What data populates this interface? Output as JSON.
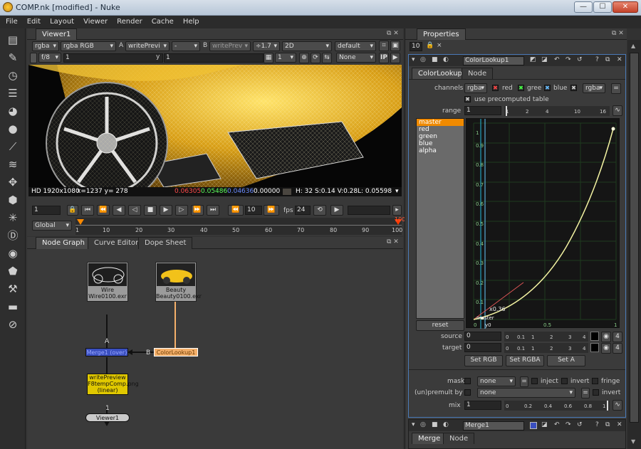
{
  "window": {
    "title": "COMP.nk [modified] - Nuke",
    "min": "—",
    "max": "☐",
    "close": "✕"
  },
  "menu": [
    "File",
    "Edit",
    "Layout",
    "Viewer",
    "Render",
    "Cache",
    "Help"
  ],
  "viewer": {
    "tab": "Viewer1",
    "row1": {
      "channels": "rgba",
      "display": "rgba RGB",
      "a_label": "A",
      "a_input": "writePrevi",
      "dash": "-",
      "b_label": "B",
      "b_input": "writePrev",
      "gain": "÷1.7",
      "mode": "2D",
      "lut": "default"
    },
    "row2": {
      "fstop": "f/8",
      "gain_val": "1",
      "y_label": "y",
      "y_val": "1",
      "frame": "1",
      "proxy": "None",
      "ip": "IP"
    },
    "status": {
      "format": "HD 1920x1080",
      "coords": "x=1237 y= 278",
      "r": "0.06305",
      "g": "0.05486",
      "b": "0.04636",
      "a": "0.00000",
      "hsv": "H: 32 S:0.14 V:0.28",
      "l": "L: 0.05598"
    },
    "timeline": {
      "frame": "1",
      "fps_label": "fps",
      "fps": "24",
      "range": "Global",
      "ticks": [
        "1",
        "10",
        "20",
        "30",
        "40",
        "50",
        "60",
        "70",
        "80",
        "90",
        "100"
      ],
      "end": "100"
    }
  },
  "nodegraph": {
    "tabs": [
      "Node Graph",
      "Curve Editor",
      "Dope Sheet"
    ],
    "nodes": {
      "wire": {
        "label": "Wire",
        "file": "Wire0100.exr"
      },
      "beauty": {
        "label": "Beauty",
        "file": "Beauty0100.exr"
      },
      "merge": {
        "label": "Merge1 (over)"
      },
      "lookup": {
        "label": "ColorLookup1"
      },
      "write": {
        "label": "writePreview",
        "file": "F8tempComp.png",
        "extra": "(linear)"
      },
      "viewer": {
        "label": "Viewer1"
      }
    },
    "pipes": {
      "a": "A",
      "b": "B",
      "one": "1"
    }
  },
  "properties": {
    "tab": "Properties",
    "max_panels": "10",
    "node_name": "ColorLookup1",
    "subtabs": [
      "ColorLookup",
      "Node"
    ],
    "channels": {
      "label": "channels",
      "value": "rgba",
      "red": "red",
      "green": "gree",
      "blue": "blue",
      "alpha": "rgba",
      "eq": "="
    },
    "precomp": "use precomputed table",
    "range": {
      "label": "range",
      "value": "1",
      "ticks": [
        "1",
        "2",
        "4",
        "10",
        "16"
      ]
    },
    "curves": [
      "master",
      "red",
      "green",
      "blue",
      "alpha"
    ],
    "reset": "reset",
    "curve": {
      "x_ticks": [
        "0",
        "0.5",
        "1"
      ],
      "y_ticks": [
        "0.1",
        "0.2",
        "0.3",
        "0.4",
        "0.5",
        "0.6",
        "0.7",
        "0.8",
        "0.9",
        "1"
      ],
      "point_label": "x0.36",
      "axis_label": "y0",
      "master_label": "master"
    },
    "source": {
      "label": "source",
      "value": "0"
    },
    "target": {
      "label": "target",
      "value": "0"
    },
    "set_buttons": [
      "Set RGB",
      "Set RGBA",
      "Set A"
    ],
    "mask": {
      "label": "mask",
      "value": "none",
      "inject": "inject",
      "invert": "invert",
      "fringe": "fringe"
    },
    "unpremult": {
      "label": "(un)premult by",
      "value": "none",
      "invert": "invert"
    },
    "mix": {
      "label": "mix",
      "value": "1",
      "ticks": [
        "0",
        "0.2",
        "0.4",
        "0.6",
        "0.8",
        "1"
      ]
    },
    "sub_ticks": [
      "0",
      "0.1",
      "1",
      "2",
      "3",
      "4"
    ],
    "four": "4",
    "merge_panel": {
      "name": "Merge1",
      "tabs": [
        "Merge",
        "Node"
      ]
    }
  },
  "colors": {
    "accent": "#ff8a00",
    "node_yellow": "#e0c800",
    "merge_blue": "#3a4fc0",
    "lookup_orange": "#f5b06a",
    "curve": "#f3f3a2"
  }
}
